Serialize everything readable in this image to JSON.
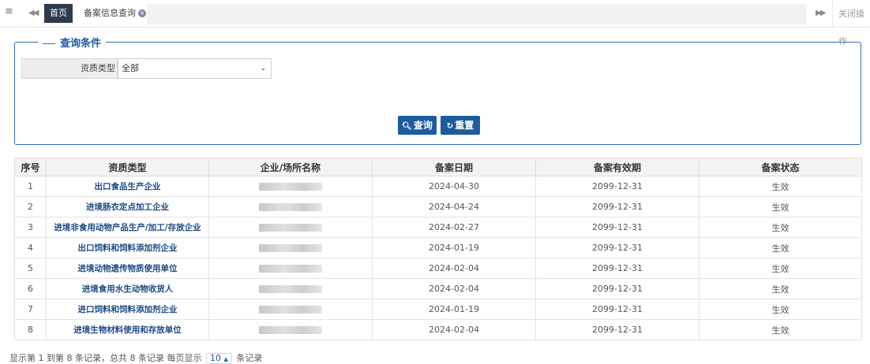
{
  "tabbar": {
    "home_tab": "首页",
    "active_tab": "备案信息查询",
    "close_ops": "关闭操作",
    "icons": {
      "menu": "hamburger-icon",
      "prev": "double-chevron-left-icon",
      "next": "double-chevron-right-icon",
      "close": "close-circle-icon"
    }
  },
  "query": {
    "legend": "查询条件",
    "field_label": "资质类型",
    "field_value": "全部",
    "search_btn": "查询",
    "reset_btn": "重置"
  },
  "table": {
    "headers": [
      "序号",
      "资质类型",
      "企业/场所名称",
      "备案日期",
      "备案有效期",
      "备案状态"
    ],
    "rows": [
      {
        "no": "1",
        "type": "出口食品生产企业",
        "date": "2024-04-30",
        "valid": "2099-12-31",
        "status": "生效"
      },
      {
        "no": "2",
        "type": "进境肠衣定点加工企业",
        "date": "2024-04-24",
        "valid": "2099-12-31",
        "status": "生效"
      },
      {
        "no": "3",
        "type": "进境非食用动物产品生产/加工/存放企业",
        "date": "2024-02-27",
        "valid": "2099-12-31",
        "status": "生效"
      },
      {
        "no": "4",
        "type": "出口饲料和饲料添加剂企业",
        "date": "2024-01-19",
        "valid": "2099-12-31",
        "status": "生效"
      },
      {
        "no": "5",
        "type": "进境动物遗传物质使用单位",
        "date": "2024-02-04",
        "valid": "2099-12-31",
        "status": "生效"
      },
      {
        "no": "6",
        "type": "进境食用水生动物收货人",
        "date": "2024-02-04",
        "valid": "2099-12-31",
        "status": "生效"
      },
      {
        "no": "7",
        "type": "进口饲料和饲料添加剂企业",
        "date": "2024-01-19",
        "valid": "2099-12-31",
        "status": "生效"
      },
      {
        "no": "8",
        "type": "进境生物材料使用和存放单位",
        "date": "2024-02-04",
        "valid": "2099-12-31",
        "status": "生效"
      }
    ]
  },
  "pager": {
    "summary": "显示第 1 到第 8 条记录，总共 8 条记录  每页显示",
    "page_size": "10",
    "suffix": "条记录"
  },
  "colors": {
    "accent": "#1c5c9e",
    "border": "#2f6fb3",
    "tab_home_bg": "#2d3a4b"
  }
}
